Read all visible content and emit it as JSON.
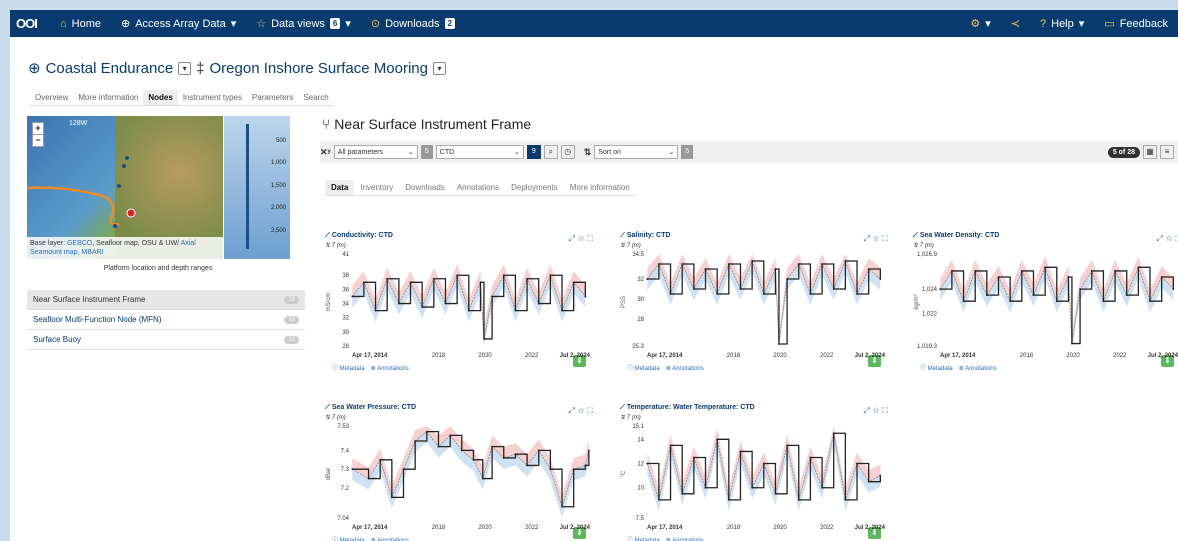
{
  "nav": {
    "logo": "OOI",
    "home": "Home",
    "access": "Access Array Data",
    "dataviews": "Data views",
    "dataviews_count": "6",
    "downloads": "Downloads",
    "downloads_count": "2",
    "help": "Help",
    "feedback": "Feedback"
  },
  "title": {
    "array": "Coastal Endurance",
    "site": "Oregon Inshore Surface Mooring"
  },
  "site_tabs": [
    "Overview",
    "More information",
    "Nodes",
    "Instrument types",
    "Parameters",
    "Search"
  ],
  "site_tabs_active": 2,
  "map": {
    "caption_prefix": "Base layer: ",
    "link1": "GEBCO",
    "caption_mid": ", Seafloor map, OSU & UW/ ",
    "link2": "Axial Seamount map, MBARI",
    "label_lon": "128W",
    "caption_below": "Platform location and depth ranges",
    "depth_ticks": [
      "500",
      "1,000",
      "1,500",
      "2,000",
      "2,500"
    ]
  },
  "nodes": [
    {
      "name": "Near Surface Instrument Frame",
      "count": "28"
    },
    {
      "name": "Seafloor Multi-Function Node (MFN)",
      "count": "23"
    },
    {
      "name": "Surface Buoy",
      "count": "13"
    }
  ],
  "frame_title": "Near Surface Instrument Frame",
  "toolbar": {
    "param_select": "All parameters",
    "param_count": "5",
    "instrument_select": "CTD",
    "instrument_count": "9",
    "sort_select": "Sort on",
    "sort_count": "5",
    "results": "5 of 28"
  },
  "panel_tabs": [
    "Data",
    "Inventory",
    "Downloads",
    "Annotations",
    "Deployments",
    "More information"
  ],
  "panel_tabs_active": 0,
  "card_footer": {
    "metadata": "Metadata",
    "annotations": "Annotations"
  },
  "colors": {
    "nav": "#0a3b6e",
    "accent": "#f5c642",
    "download": "#5cb85c",
    "upper_band": "#f5c4c4",
    "lower_band": "#c9dff2"
  },
  "chart_data": [
    {
      "type": "line",
      "title": "Conductivity: CTD",
      "depth": "7 (m)",
      "ylabel": "mS/cm",
      "yticks": [
        "41",
        "38",
        "36",
        "34",
        "32",
        "30",
        "28"
      ],
      "ytick_values": [
        41,
        38,
        36,
        34,
        32,
        30,
        28
      ],
      "ylim": [
        28,
        41
      ],
      "xticks": [
        "Apr 17, 2014",
        "2018",
        "2020",
        "2022",
        "Jul 2, 2024"
      ],
      "xtick_values": [
        2014.29,
        2018,
        2020,
        2022,
        2024.5
      ],
      "xlim": [
        2014.29,
        2024.5
      ],
      "x": [
        2014.3,
        2014.8,
        2015.3,
        2015.8,
        2016.3,
        2016.8,
        2017.3,
        2017.8,
        2018.3,
        2018.8,
        2019.3,
        2019.8,
        2019.95,
        2020.3,
        2020.8,
        2021.3,
        2021.8,
        2022.3,
        2022.8,
        2023.3,
        2023.8,
        2024.3
      ],
      "y": [
        35,
        37,
        33,
        37.5,
        34,
        37,
        33.5,
        37.5,
        34,
        38,
        33,
        37,
        29,
        35,
        38,
        33,
        37.5,
        34,
        38,
        33,
        37,
        35
      ]
    },
    {
      "type": "line",
      "title": "Salinity: CTD",
      "depth": "7 (m)",
      "ylabel": "PSS",
      "yticks": [
        "34.5",
        "32",
        "30",
        "28",
        "25.3"
      ],
      "ytick_values": [
        34.5,
        32,
        30,
        28,
        25.3
      ],
      "ylim": [
        25.3,
        34.5
      ],
      "xticks": [
        "Apr 17, 2014",
        "2018",
        "2020",
        "2022",
        "Jul 2, 2024"
      ],
      "xtick_values": [
        2014.29,
        2018,
        2020,
        2022,
        2024.5
      ],
      "xlim": [
        2014.29,
        2024.5
      ],
      "x": [
        2014.3,
        2014.8,
        2015.3,
        2015.8,
        2016.3,
        2016.8,
        2017.3,
        2017.8,
        2018.3,
        2018.8,
        2019.3,
        2019.8,
        2019.95,
        2020.3,
        2020.8,
        2021.3,
        2021.8,
        2022.3,
        2022.8,
        2023.3,
        2023.8,
        2024.3
      ],
      "y": [
        32,
        33.5,
        30.5,
        33.5,
        31,
        33,
        30.5,
        33.5,
        31,
        33.8,
        30.5,
        33,
        25.5,
        32,
        33.5,
        30.5,
        33.5,
        31,
        33.8,
        30.5,
        33,
        32
      ]
    },
    {
      "type": "line",
      "title": "Sea Water Density: CTD",
      "depth": "7 (m)",
      "ylabel": "kg/m³",
      "yticks": [
        "1,026.9",
        "1,024",
        "1,022",
        "1,019.3"
      ],
      "ytick_values": [
        1026.9,
        1024,
        1022,
        1019.3
      ],
      "ylim": [
        1019.3,
        1026.9
      ],
      "xticks": [
        "Apr 17, 2014",
        "2018",
        "2020",
        "2022",
        "Jul 2, 2024"
      ],
      "xtick_values": [
        2014.29,
        2018,
        2020,
        2022,
        2024.5
      ],
      "xlim": [
        2014.29,
        2024.5
      ],
      "x": [
        2014.3,
        2014.8,
        2015.3,
        2015.8,
        2016.3,
        2016.8,
        2017.3,
        2017.8,
        2018.3,
        2018.8,
        2019.3,
        2019.8,
        2019.95,
        2020.3,
        2020.8,
        2021.3,
        2021.8,
        2022.3,
        2022.8,
        2023.3,
        2023.8,
        2024.3
      ],
      "y": [
        1024,
        1025.5,
        1023,
        1025.5,
        1023.5,
        1025,
        1023,
        1025.5,
        1023.5,
        1025.8,
        1023,
        1025,
        1019.5,
        1024,
        1025.5,
        1023,
        1025.5,
        1023.5,
        1025.8,
        1023,
        1025,
        1024
      ]
    },
    {
      "type": "line",
      "title": "Sea Water Pressure: CTD",
      "depth": "7 (m)",
      "ylabel": "dBar",
      "yticks": [
        "7.53",
        "7.4",
        "7.3",
        "7.2",
        "7.04"
      ],
      "ytick_values": [
        7.53,
        7.4,
        7.3,
        7.2,
        7.04
      ],
      "ylim": [
        7.04,
        7.53
      ],
      "xticks": [
        "Apr 17, 2014",
        "2018",
        "2020",
        "2022",
        "Jul 2, 2024"
      ],
      "xtick_values": [
        2014.29,
        2018,
        2020,
        2022,
        2024.5
      ],
      "xlim": [
        2014.29,
        2024.5
      ],
      "x": [
        2014.3,
        2015.0,
        2015.5,
        2016.0,
        2016.5,
        2017.0,
        2017.5,
        2018.0,
        2018.5,
        2019.0,
        2019.5,
        2019.9,
        2020.3,
        2020.8,
        2021.3,
        2021.8,
        2022.3,
        2022.8,
        2023.3,
        2023.8,
        2024.3,
        2024.45
      ],
      "y": [
        7.3,
        7.25,
        7.35,
        7.15,
        7.3,
        7.45,
        7.5,
        7.42,
        7.48,
        7.4,
        7.35,
        7.25,
        7.42,
        7.36,
        7.38,
        7.32,
        7.4,
        7.3,
        7.1,
        7.3,
        7.32,
        7.4
      ]
    },
    {
      "type": "line",
      "title": "Temperature: Water Temperature: CTD",
      "depth": "7 (m)",
      "ylabel": "°C",
      "yticks": [
        "15.1",
        "14",
        "12",
        "10",
        "7.5"
      ],
      "ytick_values": [
        15.1,
        14,
        12,
        10,
        7.5
      ],
      "ylim": [
        7.5,
        15.1
      ],
      "xticks": [
        "Apr 17, 2014",
        "2018",
        "2020",
        "2022",
        "Jul 2, 2024"
      ],
      "xtick_values": [
        2014.29,
        2018,
        2020,
        2022,
        2024.5
      ],
      "xlim": [
        2014.29,
        2024.5
      ],
      "x": [
        2014.3,
        2014.8,
        2015.3,
        2015.8,
        2016.3,
        2016.8,
        2017.3,
        2017.8,
        2018.3,
        2018.8,
        2019.3,
        2019.8,
        2020.3,
        2020.8,
        2021.3,
        2021.8,
        2022.3,
        2022.8,
        2023.3,
        2023.8,
        2024.3
      ],
      "y": [
        12,
        9,
        13.5,
        9.5,
        12.5,
        10,
        14,
        9,
        13,
        10,
        12,
        9.5,
        13.5,
        9,
        12.5,
        10,
        14.5,
        9,
        12,
        10.5,
        11
      ]
    }
  ]
}
